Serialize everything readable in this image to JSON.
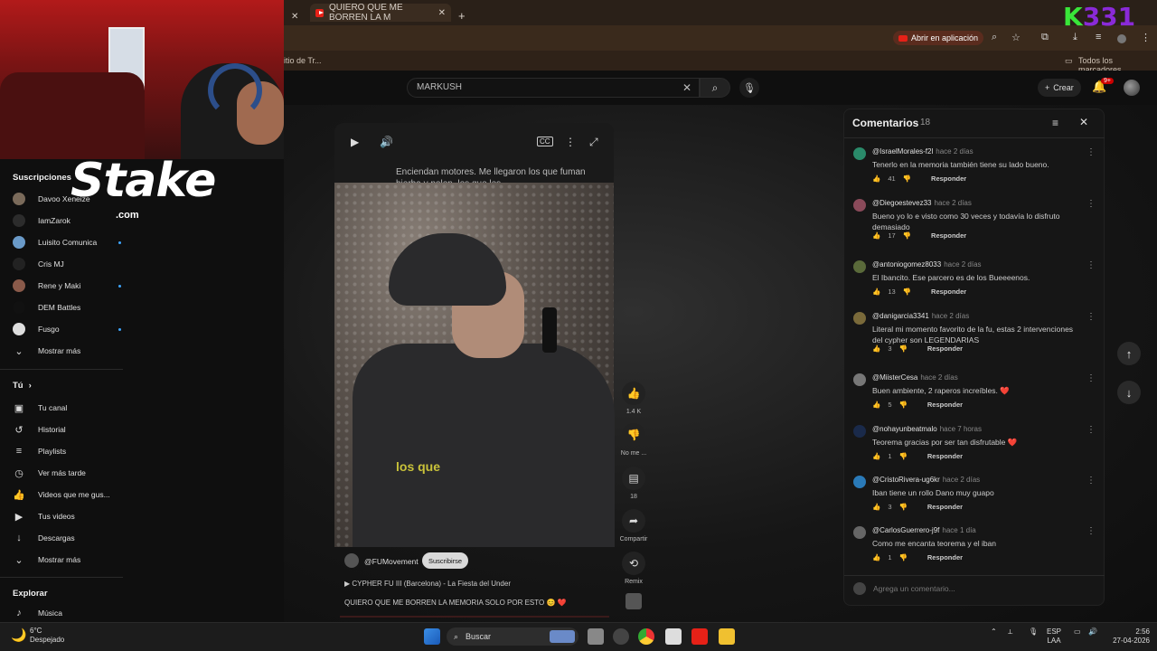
{
  "browser": {
    "active_tab_title": "QUIERO QUE ME BORREN LA M",
    "open_in_app_label": "Abrir en aplicación",
    "bookmark_left": "itio de Tr...",
    "bookmarks_all": "Todos los marcadores"
  },
  "overlay": {
    "stake": "Stake",
    "stake_com": ".com",
    "k331_k": "K",
    "k331_num": "331"
  },
  "header": {
    "search_value": "MARKUSH",
    "create_label": "Crear",
    "notif_badge": "9+"
  },
  "sidebar": {
    "subscriptions_title": "Suscripciones",
    "subscriptions": [
      {
        "label": "Davoo Xeneize",
        "color": "#7a6a5a",
        "dot": false
      },
      {
        "label": "IamZarok",
        "color": "#2c2c2c",
        "dot": false
      },
      {
        "label": "Luisito Comunica",
        "color": "#6a9ac8",
        "dot": true
      },
      {
        "label": "Cris MJ",
        "color": "#222",
        "dot": false
      },
      {
        "label": "Rene y Maki",
        "color": "#8a5a4a",
        "dot": true
      },
      {
        "label": "DEM Battles",
        "color": "#111",
        "dot": false
      },
      {
        "label": "Fusgo",
        "color": "#ddd",
        "dot": true
      }
    ],
    "show_more": "Mostrar más",
    "you_title": "Tú",
    "you_items": [
      {
        "label": "Tu canal",
        "icon": "channel-icon",
        "glyph": "▣"
      },
      {
        "label": "Historial",
        "icon": "history-icon",
        "glyph": "↺"
      },
      {
        "label": "Playlists",
        "icon": "playlists-icon",
        "glyph": "≡"
      },
      {
        "label": "Ver más tarde",
        "icon": "watch-later-icon",
        "glyph": "◷"
      },
      {
        "label": "Videos que me gus...",
        "icon": "like-icon",
        "glyph": "👍"
      },
      {
        "label": "Tus videos",
        "icon": "your-videos-icon",
        "glyph": "▶"
      },
      {
        "label": "Descargas",
        "icon": "download-icon",
        "glyph": "↓"
      },
      {
        "label": "Mostrar más",
        "icon": "chevron-down-icon",
        "glyph": "⌄"
      }
    ],
    "explore_title": "Explorar",
    "explore_items": [
      {
        "label": "Música",
        "icon": "music-icon",
        "glyph": "♪"
      }
    ]
  },
  "short": {
    "subtitle_top": "Enciendan motores. Me llegaron los que fuman hierba y polen, los que les",
    "subtitle_mid": "los que",
    "likes": "1.4 K",
    "dislike_label": "No me ...",
    "comments_count": "18",
    "share_label": "Compartir",
    "remix_label": "Remix",
    "channel": "@FUMovement",
    "subscribe_label": "Suscribirse",
    "playlist": "CYPHER FU III (Barcelona) - La Fiesta del Under",
    "title": "QUIERO QUE ME BORREN LA MEMORIA SOLO POR ESTO 😊 ❤️"
  },
  "comments": {
    "title": "Comentarios",
    "count": "18",
    "reply_label": "Responder",
    "add_placeholder": "Agrega un comentario...",
    "items": [
      {
        "user": "@IsraelMorales-f2l",
        "ago": "hace 2 días",
        "text": "Tenerlo en la memoria también tiene su lado bueno.",
        "likes": "41",
        "color": "#2a8a6a"
      },
      {
        "user": "@Diegoestevez33",
        "ago": "hace 2 días",
        "text": "Bueno yo lo e visto como 30 veces y todavía lo disfruto demasiado",
        "likes": "17",
        "color": "#8a4a5a"
      },
      {
        "user": "@antoniogomez8033",
        "ago": "hace 2 días",
        "text": "El Ibancito. Ese parcero es de los Bueeeenos.",
        "likes": "13",
        "color": "#5a6a3a"
      },
      {
        "user": "@danigarcia3341",
        "ago": "hace 2 días",
        "text": "Literal mi momento favorito de la fu, estas 2 intervenciones del cypher son LEGENDARIAS",
        "likes": "3",
        "color": "#7a6a3a"
      },
      {
        "user": "@MiisterCesa",
        "ago": "hace 2 días",
        "text": "Buen ambiente, 2 raperos increíbles. ❤️",
        "likes": "5",
        "color": "#777"
      },
      {
        "user": "@nohayunbeatmalo",
        "ago": "hace 7 horas",
        "text": "Teorema gracias por ser tan disfrutable ❤️",
        "likes": "1",
        "color": "#1a2a4a"
      },
      {
        "user": "@CristoRivera-ug6kr",
        "ago": "hace 2 días",
        "text": "Iban tiene un rollo Dano muy guapo",
        "likes": "3",
        "color": "#2a7ab8"
      },
      {
        "user": "@CarlosGuerrero-j9f",
        "ago": "hace 1 día",
        "text": "Como me encanta teorema y el iban",
        "likes": "1",
        "color": "#666"
      }
    ]
  },
  "taskbar": {
    "weather_temp": "6°C",
    "weather_desc": "Despejado",
    "search_label": "Buscar",
    "lang": "ESP",
    "lang2": "LAA",
    "time": "2:56",
    "date": "27-04-2026"
  }
}
